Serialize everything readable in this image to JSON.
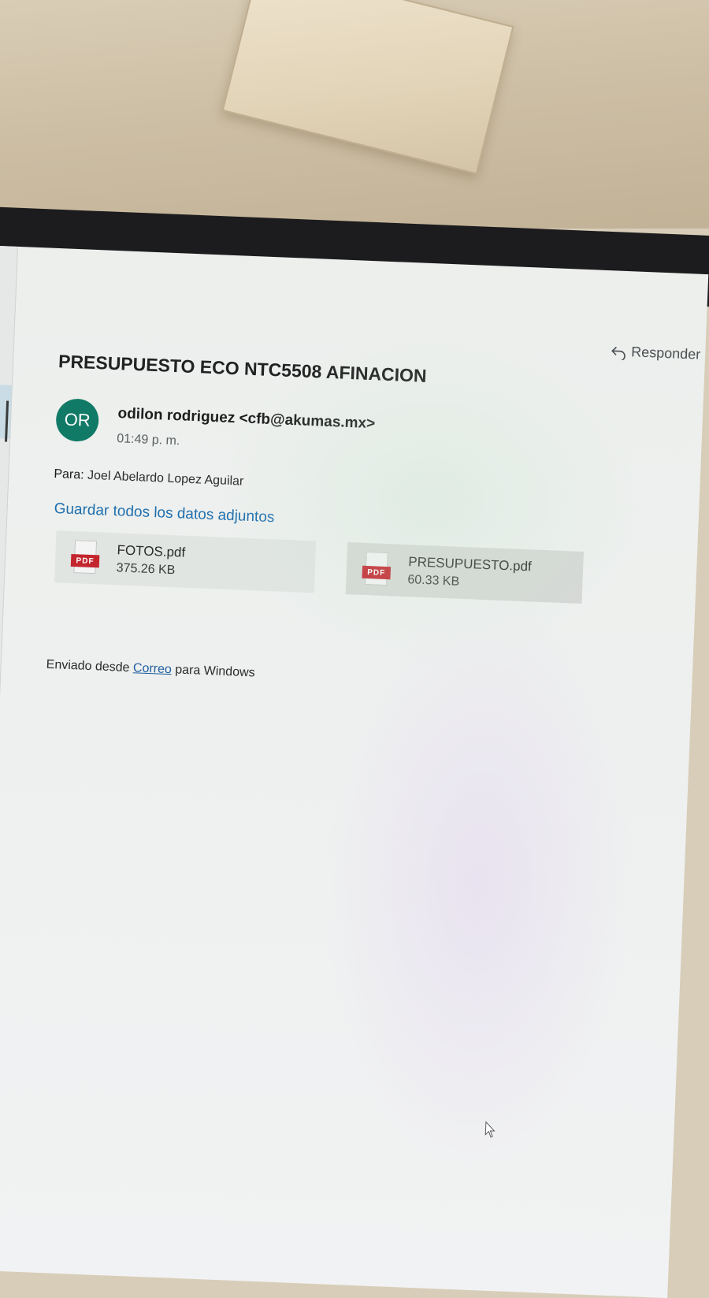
{
  "toolbar": {
    "reply_label": "Responder",
    "reply_icon": "reply-arrow-icon"
  },
  "message": {
    "subject": "PRESUPUESTO ECO NTC5508 AFINACION",
    "sender": {
      "initials": "OR",
      "avatar_color": "#117a66",
      "display": "odilon rodriguez <cfb@akumas.mx>"
    },
    "time": "01:49 p. m.",
    "to_label": "Para:",
    "to_value": "Joel Abelardo Lopez Aguilar",
    "save_all_label": "Guardar todos los datos adjuntos",
    "attachments": [
      {
        "icon": "pdf-file-icon",
        "type_tag": "PDF",
        "name": "FOTOS.pdf",
        "size": "375.26 KB"
      },
      {
        "icon": "pdf-file-icon",
        "type_tag": "PDF",
        "name": "PRESUPUESTO.pdf",
        "size": "60.33 KB"
      }
    ],
    "signature": {
      "prefix": "Enviado desde",
      "link": "Correo",
      "suffix": "para Windows"
    }
  },
  "colors": {
    "accent_link": "#1f6fae",
    "pdf_tag": "#c4262e"
  }
}
